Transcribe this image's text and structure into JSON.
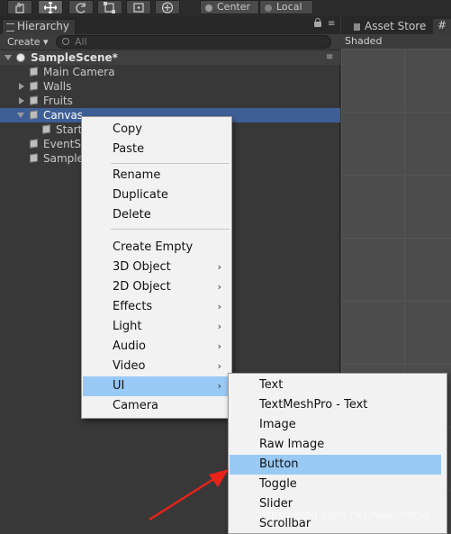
{
  "toolbar": {
    "pivot_label": "Center",
    "space_label": "Local"
  },
  "hierarchy": {
    "tab_label": "Hierarchy",
    "create_label": "Create ▾",
    "search_placeholder": "All",
    "scene_name": "SampleScene*",
    "items": [
      {
        "label": "Main Camera"
      },
      {
        "label": "Walls"
      },
      {
        "label": "Fruits"
      },
      {
        "label": "Canvas"
      },
      {
        "label": "Start"
      },
      {
        "label": "EventSy"
      },
      {
        "label": "Sample"
      }
    ]
  },
  "scene_panel": {
    "asset_store_tab": "Asset Store",
    "draw_mode": "Shaded"
  },
  "context_menu": {
    "items": [
      "Copy",
      "Paste",
      "Rename",
      "Duplicate",
      "Delete",
      "Create Empty",
      "3D Object",
      "2D Object",
      "Effects",
      "Light",
      "Audio",
      "Video",
      "UI",
      "Camera"
    ],
    "submenu_arrow": "›"
  },
  "ui_submenu": {
    "items": [
      "Text",
      "TextMeshPro - Text",
      "Image",
      "Raw Image",
      "Button",
      "Toggle",
      "Slider",
      "Scrollbar"
    ]
  },
  "watermark": "https://blog.csdn.net/newchenxf",
  "colors": {
    "selection": "#3e5f96",
    "menu_highlight": "#99c9f5",
    "annotation_arrow": "#e8231a"
  }
}
